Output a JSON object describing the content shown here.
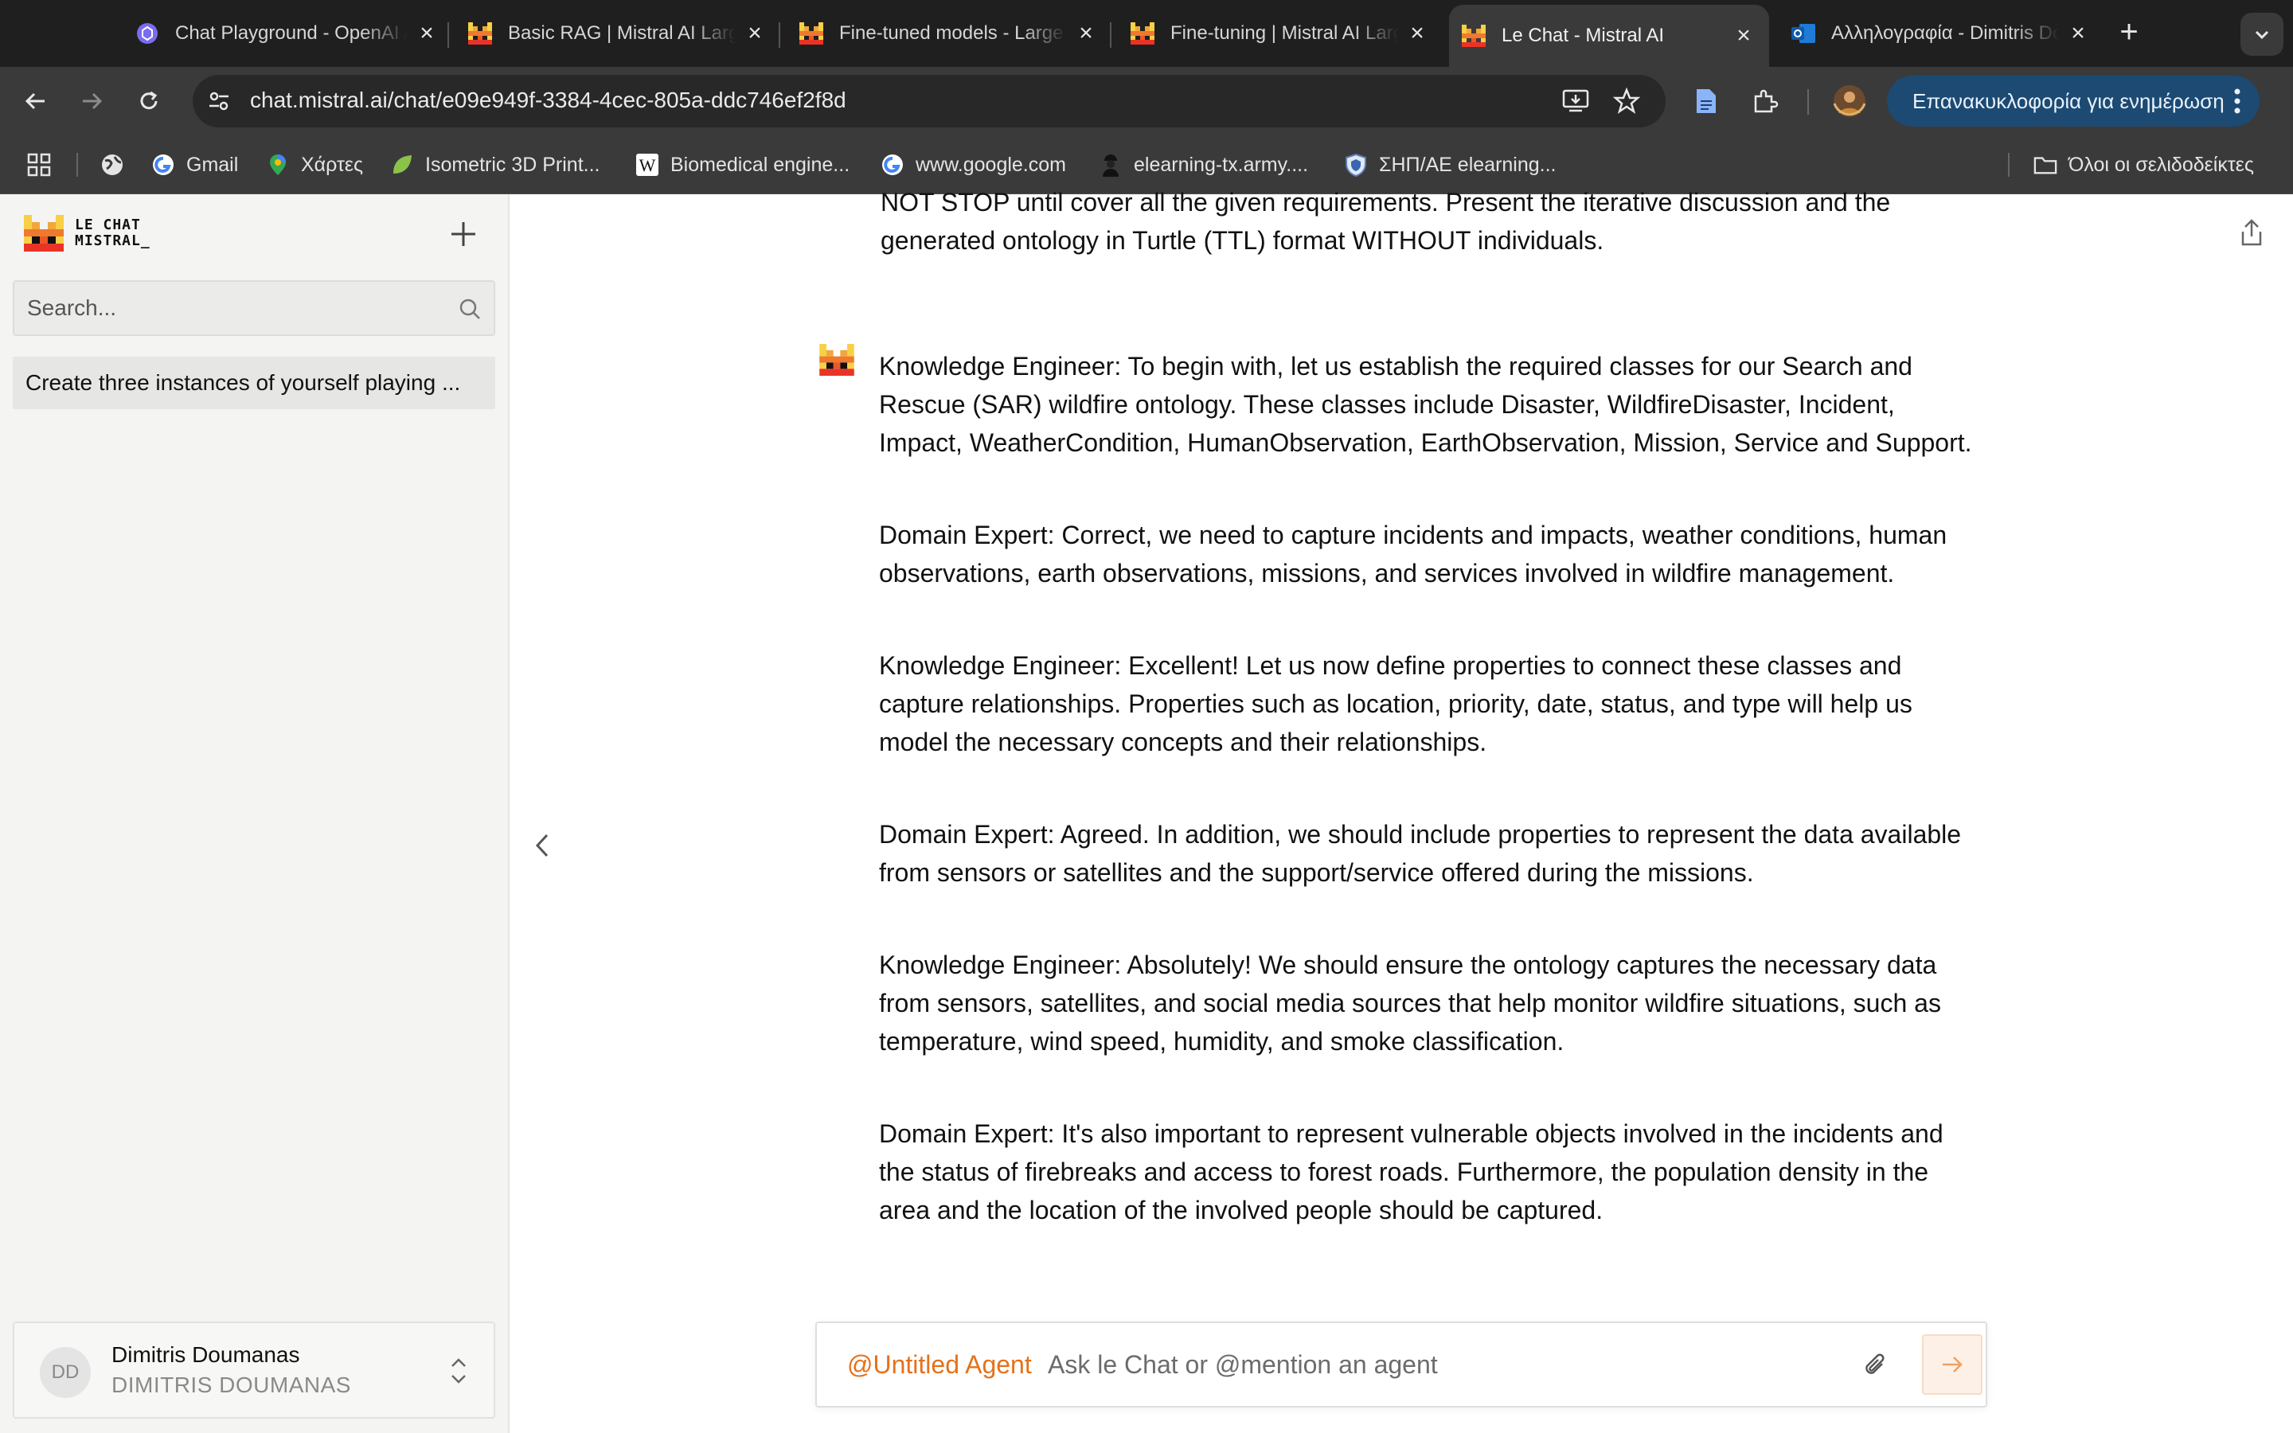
{
  "browser": {
    "tabs": [
      {
        "title": "Chat Playground - OpenAI API",
        "icon": "openai-icon"
      },
      {
        "title": "Basic RAG | Mistral AI Large Language Models",
        "icon": "mistral-icon"
      },
      {
        "title": "Fine-tuned models - Large Language Models",
        "icon": "mistral-icon"
      },
      {
        "title": "Fine-tuning | Mistral AI Large Language Models",
        "icon": "mistral-icon"
      },
      {
        "title": "Le Chat - Mistral AI",
        "icon": "mistral-icon",
        "active": true
      },
      {
        "title": "Αλληλογραφία - Dimitris Doumanas - Outlook",
        "icon": "outlook-icon"
      }
    ],
    "url": "chat.mistral.ai/chat/e09e949f-3384-4cec-805a-ddc746ef2f8d",
    "update_label": "Επανακυκλοφορία για ενημέρωση",
    "bookmarks": [
      {
        "label": "Gmail",
        "icon": "google-icon"
      },
      {
        "label": "Χάρτες",
        "icon": "maps-icon"
      },
      {
        "label": "Isometric 3D Print...",
        "icon": "leaf-icon"
      },
      {
        "label": "Biomedical engine...",
        "icon": "wikipedia-icon"
      },
      {
        "label": "www.google.com",
        "icon": "google-icon"
      },
      {
        "label": "elearning-tx.army....",
        "icon": "soldier-icon"
      },
      {
        "label": "ΣΗΠ/ΑΕ elearning...",
        "icon": "shield-icon"
      }
    ],
    "all_bookmarks_label": "Όλοι οι σελιδοδείκτες"
  },
  "sidebar": {
    "logo_line1": "LE CHAT",
    "logo_line2": "MISTRAL_",
    "search_placeholder": "Search...",
    "history": [
      "Create three instances of yourself playing ..."
    ],
    "user": {
      "initials": "DD",
      "name": "Dimitris Doumanas",
      "subtitle": "DIMITRIS DOUMANAS"
    }
  },
  "chat": {
    "user_message_tail": "NOT STOP until cover all the given requirements. Present the iterative discussion and the generated ontology in Turtle (TTL) format WITHOUT individuals.",
    "assistant_paragraphs": [
      "Knowledge Engineer: To begin with, let us establish the required classes for our Search and Rescue (SAR) wildfire ontology. These classes include Disaster, WildfireDisaster, Incident, Impact, WeatherCondition, HumanObservation, EarthObservation, Mission, Service and Support.",
      "Domain Expert: Correct, we need to capture incidents and impacts, weather conditions, human observations, earth observations, missions, and services involved in wildfire management.",
      "Knowledge Engineer: Excellent! Let us now define properties to connect these classes and capture relationships. Properties such as location, priority, date, status, and type will help us model the necessary concepts and their relationships.",
      "Domain Expert: Agreed. In addition, we should include properties to represent the data available from sensors or satellites and the support/service offered during the missions.",
      "Knowledge Engineer: Absolutely! We should ensure the ontology captures the necessary data from sensors, satellites, and social media sources that help monitor wildfire situations, such as temperature, wind speed, humidity, and smoke classification.",
      "Domain Expert: It's also important to represent vulnerable objects involved in the incidents and the status of firebreaks and access to forest roads. Furthermore, the population density in the area and the location of the involved people should be captured."
    ]
  },
  "composer": {
    "agent_tag": "@Untitled Agent",
    "placeholder": "Ask le Chat or @mention an agent"
  },
  "colors": {
    "accent": "#e5711a",
    "chrome_dark": "#1f1f1f",
    "chrome_mid": "#3a3a3a",
    "update_button": "#1c4a72",
    "sidebar_bg": "#f4f4f3"
  }
}
